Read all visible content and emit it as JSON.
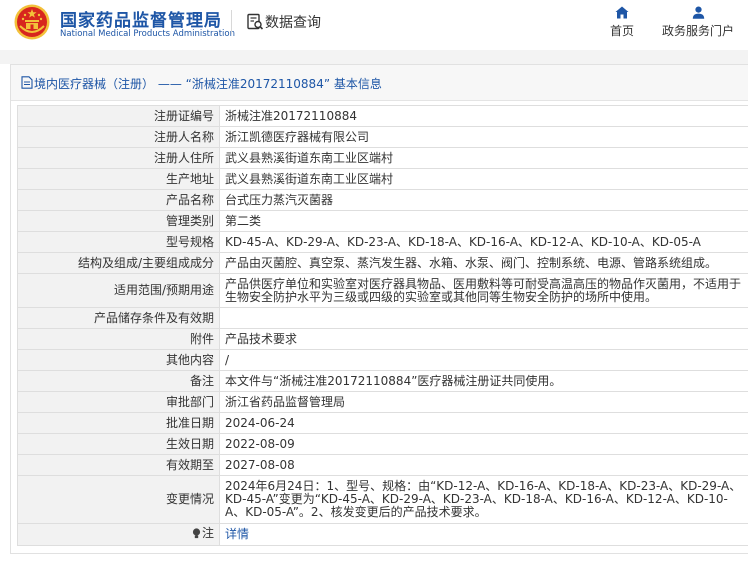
{
  "header": {
    "brand_cn": "国家药品监督管理局",
    "brand_en": "National Medical Products Administration",
    "query_label": "数据查询",
    "nav": [
      {
        "label": "首页",
        "icon": "home-icon"
      },
      {
        "label": "政务服务门户",
        "icon": "user-icon"
      }
    ]
  },
  "panel": {
    "title": "境内医疗器械（注册） —— “浙械注准20172110884” 基本信息"
  },
  "rows": [
    {
      "key": "注册证编号",
      "value": "浙械注准20172110884"
    },
    {
      "key": "注册人名称",
      "value": "浙江凯德医疗器械有限公司"
    },
    {
      "key": "注册人住所",
      "value": "武义县熟溪街道东南工业区端村"
    },
    {
      "key": "生产地址",
      "value": "武义县熟溪街道东南工业区端村"
    },
    {
      "key": "产品名称",
      "value": "台式压力蒸汽灭菌器"
    },
    {
      "key": "管理类别",
      "value": "第二类"
    },
    {
      "key": "型号规格",
      "value": "KD-45-A、KD-29-A、KD-23-A、KD-18-A、KD-16-A、KD-12-A、KD-10-A、KD-05-A"
    },
    {
      "key": "结构及组成/主要组成成分",
      "value": "产品由灭菌腔、真空泵、蒸汽发生器、水箱、水泵、阀门、控制系统、电源、管路系统组成。"
    },
    {
      "key": "适用范围/预期用途",
      "value": "产品供医疗单位和实验室对医疗器具物品、医用敷料等可耐受高温高压的物品作灭菌用，不适用于生物安全防护水平为三级或四级的实验室或其他同等生物安全防护的场所中使用。"
    },
    {
      "key": "产品储存条件及有效期",
      "value": ""
    },
    {
      "key": "附件",
      "value": "产品技术要求"
    },
    {
      "key": "其他内容",
      "value": "/"
    },
    {
      "key": "备注",
      "value": "本文件与“浙械注准20172110884”医疗器械注册证共同使用。"
    },
    {
      "key": "审批部门",
      "value": "浙江省药品监督管理局"
    },
    {
      "key": "批准日期",
      "value": "2024-06-24"
    },
    {
      "key": "生效日期",
      "value": "2022-08-09"
    },
    {
      "key": "有效期至",
      "value": "2027-08-08"
    },
    {
      "key": "变更情况",
      "value": "2024年6月24日：1、型号、规格：由“KD-12-A、KD-16-A、KD-18-A、KD-23-A、KD-29-A、KD-45-A”变更为“KD-45-A、KD-29-A、KD-23-A、KD-18-A、KD-16-A、KD-12-A、KD-10-A、KD-05-A”。2、核发变更后的产品技术要求。"
    }
  ],
  "note_row": {
    "key": "注",
    "icon": "bulb-icon",
    "link": "详情"
  },
  "colors": {
    "brand": "#1e56a6",
    "label_bg": "#f2f2f2",
    "emblem_red": "#d7261e",
    "emblem_gold": "#f3c13a"
  }
}
